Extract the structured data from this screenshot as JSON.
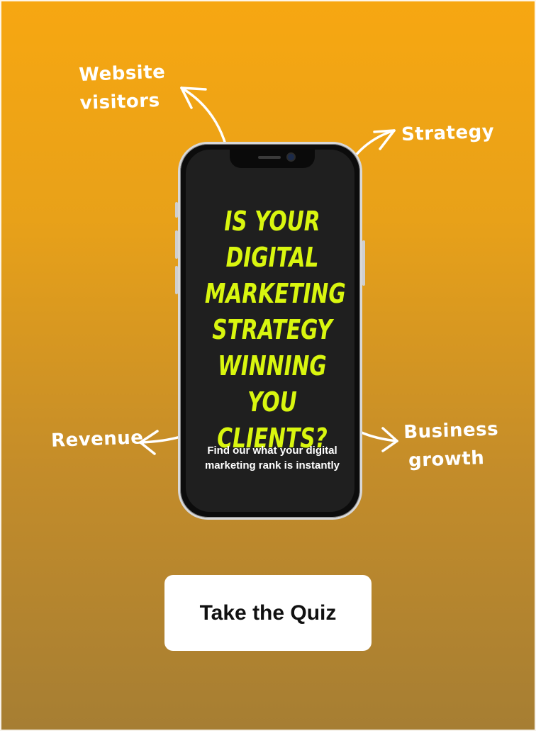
{
  "labels": {
    "website_visitors": [
      "Website",
      "visitors"
    ],
    "strategy": "Strategy",
    "revenue": "Revenue",
    "business_growth": [
      "Business",
      "growth"
    ]
  },
  "phone_screen": {
    "headline_lines": [
      "IS YOUR",
      "DIGITAL",
      "MARKETING",
      "STRATEGY",
      "WINNING",
      "YOU CLIENTS?"
    ],
    "subtext_lines": [
      "Find our what your digital",
      "marketing rank is instantly"
    ]
  },
  "cta": {
    "label": "Take the Quiz"
  },
  "colors": {
    "headline": "#d9f60f",
    "background_top": "#f7a711",
    "background_bottom": "#a67e33",
    "button": "#ffffff"
  },
  "icons": [
    "arrow-website-visitors-icon",
    "arrow-strategy-icon",
    "arrow-revenue-icon",
    "arrow-business-growth-icon"
  ]
}
